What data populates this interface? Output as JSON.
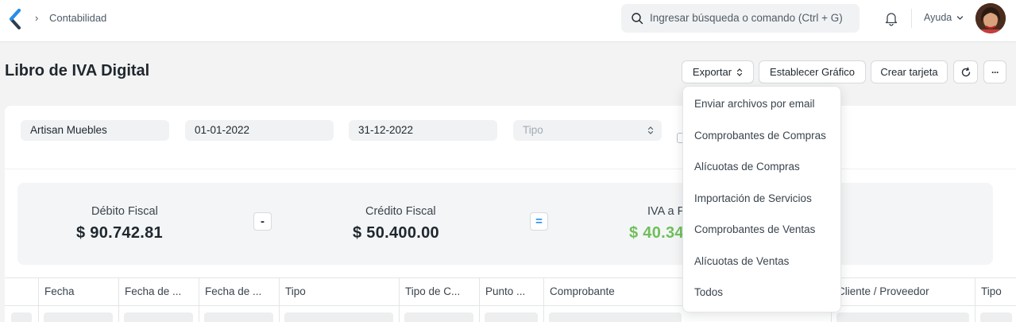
{
  "navbar": {
    "breadcrumb": "Contabilidad",
    "breadcrumb_separator": "›",
    "search_placeholder": "Ingresar búsqueda o comando (Ctrl + G)",
    "help_label": "Ayuda",
    "icons": [
      "app-logo-icon",
      "search-icon",
      "bell-icon",
      "chevron-down-icon"
    ]
  },
  "page": {
    "title": "Libro de IVA Digital",
    "buttons": {
      "export": "Exportar",
      "set_chart": "Establecer Gráfico",
      "create_card": "Crear tarjeta",
      "reload_icon": "reload-icon",
      "more_icon": "more-icon",
      "more_text": "···"
    }
  },
  "filters": {
    "company": "Artisan Muebles",
    "from_date": "01-01-2022",
    "to_date": "31-12-2022",
    "type_placeholder": "Tipo"
  },
  "summary": {
    "debit_label": "Débito Fiscal",
    "debit_value": "$ 90.742.81",
    "minus_op": "-",
    "credit_label": "Crédito Fiscal",
    "credit_value": "$ 50.400.00",
    "equals_op": "=",
    "result_label": "IVA a P",
    "result_value": "$ 40.34",
    "result_color": "#6fbf5a"
  },
  "table": {
    "columns": [
      "Fecha",
      "Fecha de ...",
      "Fecha de ...",
      "Tipo",
      "Tipo de C...",
      "Punto ...",
      "Comprobante",
      "",
      "Cliente / Proveedor",
      "Tipo"
    ]
  },
  "export_menu": {
    "items": [
      "Enviar archivos por email",
      "Comprobantes de Compras",
      "Alícuotas de Compras",
      "Importación de Servicios",
      "Comprobantes de Ventas",
      "Alícuotas de Ventas",
      "Todos"
    ]
  },
  "colors": {
    "accent": "#2490ef",
    "success": "#6fbf5a",
    "background": "#f3f3f3"
  }
}
